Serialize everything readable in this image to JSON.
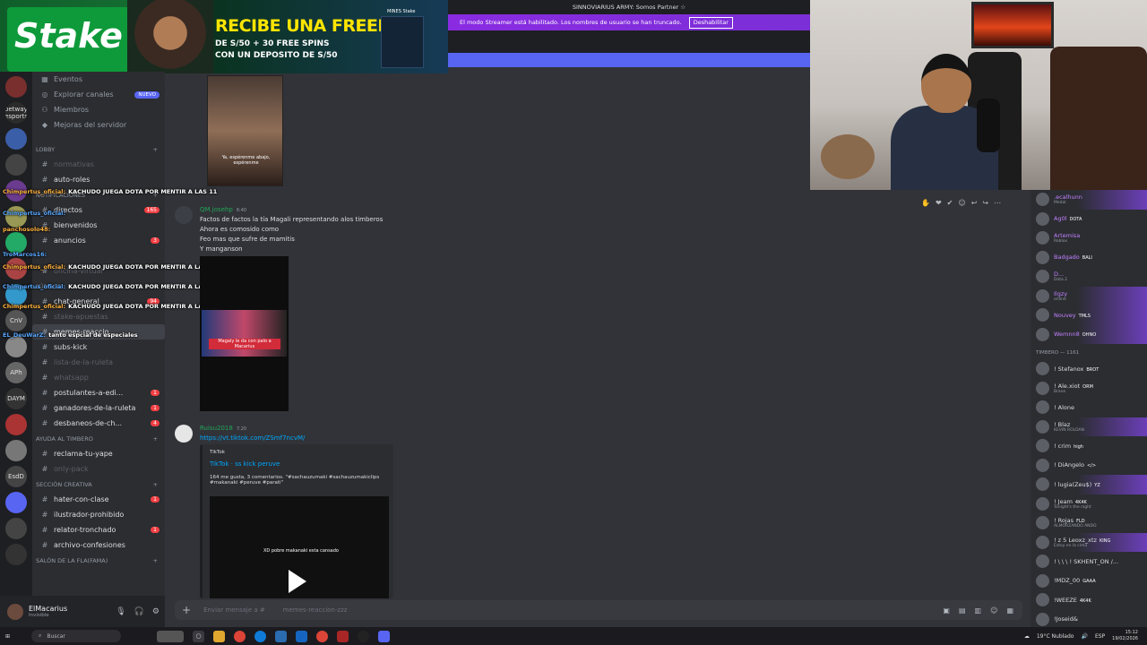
{
  "ad": {
    "logo": "Stake",
    "headline": "RECIBE UNA FREEBET",
    "line1": "DE S/50 + 30 FREE SPINS",
    "line2": "CON UN DEPOSITO DE S/50",
    "tag": "MINES Stake",
    "age": "18"
  },
  "topbar": {
    "server_title": "SINNOVIARIUS ARMY: Somos Partner ☆",
    "streamer_notice": "El modo Streamer está habilitado. Los nombres de usuario se han truncado.",
    "disable_button": "Deshabilitar"
  },
  "rail": [
    "",
    "betway esports",
    "",
    "",
    "",
    "",
    "",
    "",
    "",
    "CnV",
    "",
    "APh",
    "DAYM",
    "",
    "",
    "EsdD",
    "",
    "",
    ""
  ],
  "sidebar": {
    "top": [
      {
        "icon": "calendar",
        "label": "Eventos"
      },
      {
        "icon": "compass",
        "label": "Explorar canales",
        "pill": "NUEVO"
      },
      {
        "icon": "people",
        "label": "Miembros"
      },
      {
        "icon": "boost",
        "label": "Mejoras del servidor"
      }
    ],
    "sections": [
      {
        "category": "LOBBY",
        "channels": [
          {
            "label": "normativas",
            "muted": true
          },
          {
            "label": "auto-roles"
          }
        ]
      },
      {
        "category": "NOTIFICACIONES",
        "channels": [
          {
            "label": "directos",
            "unread": "165"
          },
          {
            "label": "bienvenidos"
          },
          {
            "label": "anuncios",
            "unread": "3"
          }
        ]
      },
      {
        "category": "",
        "channels": [
          {
            "label": "oficina-virtual",
            "muted": true
          }
        ]
      },
      {
        "category": "PÚBLICO",
        "channels": [
          {
            "label": "chat-general",
            "unread": "94"
          },
          {
            "label": "stake-apuestas",
            "muted": true
          },
          {
            "label": "memes-reaccio...",
            "active": true
          },
          {
            "label": "subs-kick"
          },
          {
            "label": "lista-de-la-ruleta",
            "muted": true
          },
          {
            "label": "whatsapp",
            "muted": true
          },
          {
            "label": "postulantes-a-edi...",
            "unread": "1"
          },
          {
            "label": "ganadores-de-la-ruleta",
            "unread": "1"
          },
          {
            "label": "desbaneos-de-ch...",
            "unread": "4"
          }
        ]
      },
      {
        "category": "AYUDA AL TIMBERO",
        "channels": [
          {
            "label": "reclama-tu-yape"
          },
          {
            "label": "only-pack",
            "muted": true
          }
        ]
      },
      {
        "category": "SECCIÓN CREATIVA",
        "channels": [
          {
            "label": "hater-con-clase",
            "unread": "1"
          },
          {
            "label": "ilustrador-prohibido"
          },
          {
            "label": "relator-tronchado",
            "unread": "1"
          },
          {
            "label": "archivo-confesiones"
          }
        ]
      },
      {
        "category": "SALÓN DE LA FLA(FAMA)",
        "channels": []
      }
    ]
  },
  "user": {
    "name": "ElMacarius",
    "status": "Invisible"
  },
  "overlay_chat": [
    {
      "user": "Chimpertus_oficial:",
      "text": "KACHUDO JUEGA DOTA POR MENTIR A LAS 11"
    },
    {
      "user": "Chimpertus_oficial:",
      "text": ""
    },
    {
      "user": "panchosolo48:",
      "text": ""
    },
    {
      "user": "TroMarcos16:",
      "text": ""
    },
    {
      "user": "Chimpertus_oficial:",
      "text": "KACHUDO JUEGA DOTA POR MENTIR A LAS 11"
    },
    {
      "user": "Chimpertus_oficial:",
      "text": "KACHUDO JUEGA DOTA POR MENTIR A LAS 11"
    },
    {
      "user": "Chimpertus_oficial:",
      "text": "KACHUDO JUEGA DOTA POR MENTIR A LAS 11"
    },
    {
      "user": "EL_DeuWarZ:",
      "text": "tanto espcial de especiales"
    }
  ],
  "messages": [
    {
      "author": "QM.josehp",
      "time": "6:40",
      "lines": [
        "Factos de factos la tía Magali representando alos timberos",
        "Ahora es comosido como",
        "Feo mas que sufre de mamitis",
        "Y manganson"
      ],
      "media_caption": "Magaly le da con palo a Macarius"
    },
    {
      "author": "Ruisu2018",
      "time": "7:20",
      "link": "https://vt.tiktok.com/ZSmf7ncvM/",
      "embed": {
        "provider": "TikTok",
        "title": "TikTok · ss kick peruve",
        "desc": "164 me gusta, 3 comentarios. \"#sachauzumaki #sachauzumakiclips #makanaki #peruve #parati\"",
        "video_caption": "XD pobre makanaki esta cansado"
      }
    }
  ],
  "top_media_caption": "Ya, espérenme abajo, espérenme",
  "composer": {
    "placeholder": "Enviar mensaje a #",
    "channel_hint": "memes-reaccion-zzz"
  },
  "members": {
    "online": [
      {
        "name": ".ecalhunn",
        "sub": "Medal",
        "boost": true
      },
      {
        "name": "Ag0l",
        "tag": "DOTA"
      },
      {
        "name": "Artemisa",
        "sub": "Roblox"
      },
      {
        "name": "Badgado",
        "tag": "BALI"
      },
      {
        "name": "D...",
        "sub": "Dota 2"
      },
      {
        "name": "Ilgzy",
        "sub": "online",
        "boost": true
      },
      {
        "name": "Nouvey",
        "tag": "TMLS",
        "boost": true
      },
      {
        "name": "Wemnn8",
        "tag": "OHNO",
        "boost": true
      }
    ],
    "category": "TIMBERO — 1161",
    "timbero": [
      {
        "name": "! Stefanox",
        "tag": "BROT"
      },
      {
        "name": "! Ale.xiot",
        "sub": "Brave",
        "tag": "ORM"
      },
      {
        "name": "! Alone"
      },
      {
        "name": "! Blaz",
        "sub": "KEVIN ROLDAN",
        "boost": true
      },
      {
        "name": "! crim",
        "tag": "high"
      },
      {
        "name": "! DiAngelo",
        "tag": "</>"
      },
      {
        "name": "! lugia(Zeu$)",
        "tag": "YZ",
        "boost": true
      },
      {
        "name": "! Jeam",
        "sub": "Tonight's the night",
        "tag": "4K4K"
      },
      {
        "name": "! Rojas",
        "sub": "ALMORZANDO ANDO",
        "tag": "FLD"
      },
      {
        "name": "! z 5 Leoxz_xtz",
        "sub": "Estoy en la cima",
        "tag": "KING",
        "boost": true
      },
      {
        "name": "! \\ \\ \\ ! SKHENT_ON /..."
      },
      {
        "name": "!MDZ_00",
        "tag": "GAAA"
      },
      {
        "name": "!WEEZE",
        "tag": "4K4K"
      },
      {
        "name": "!Joseid&"
      }
    ]
  },
  "taskbar": {
    "search": "Buscar",
    "weather": "19°C Nublado",
    "lang": "ESP",
    "time": "15:12",
    "date": "19/02/2026"
  },
  "colors": {
    "accent": "#5865f2",
    "streamer_bar": "#8a2be2",
    "bg": "#313338",
    "sidebar": "#2b2d31"
  }
}
